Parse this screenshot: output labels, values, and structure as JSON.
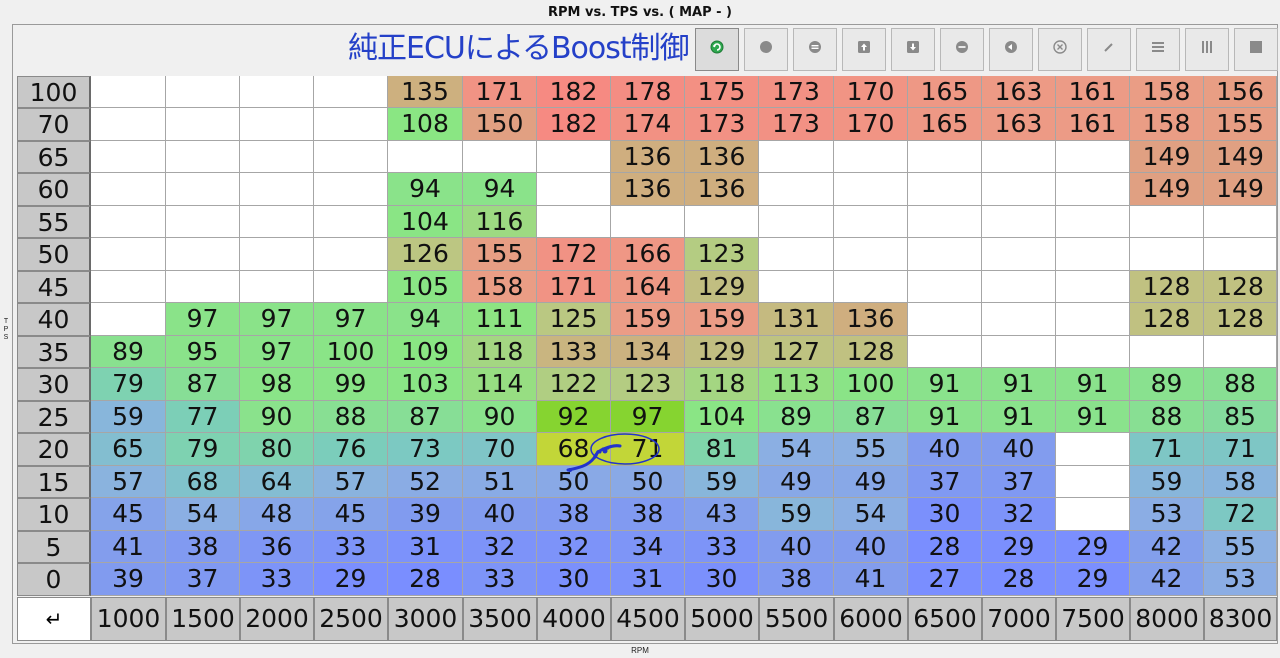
{
  "window": {
    "title": "RPM vs. TPS vs. ( MAP -   )"
  },
  "annotation": {
    "text": "純正ECUによるBoost制御",
    "color": "#2440c8"
  },
  "toolbar": {
    "buttons": [
      {
        "icon": "refresh-green-icon",
        "active": true
      },
      {
        "icon": "circle-icon",
        "active": false
      },
      {
        "icon": "equals-circle-icon",
        "active": false
      },
      {
        "icon": "arrow-up-box-icon",
        "active": false
      },
      {
        "icon": "arrow-down-box-icon",
        "active": false
      },
      {
        "icon": "minus-circle-icon",
        "active": false
      },
      {
        "icon": "plus-circle-icon",
        "active": false
      },
      {
        "icon": "x-circle-icon",
        "active": false
      },
      {
        "icon": "pencil-icon",
        "active": false
      },
      {
        "icon": "horizontal-lines-icon",
        "active": false
      },
      {
        "icon": "vertical-bars-icon",
        "active": false
      },
      {
        "icon": "filled-square-icon",
        "active": false
      }
    ]
  },
  "axes": {
    "x_label": "RPM",
    "y_label": "T P S",
    "corner_symbol": "↵"
  },
  "table": {
    "columns": [
      "1000",
      "1500",
      "2000",
      "2500",
      "3000",
      "3500",
      "4000",
      "4500",
      "5000",
      "5500",
      "6000",
      "6500",
      "7000",
      "7500",
      "8000",
      "8300"
    ],
    "rows": [
      {
        "tps": "100",
        "cells": [
          null,
          null,
          null,
          null,
          "135",
          "171",
          "182",
          "178",
          "175",
          "173",
          "170",
          "165",
          "163",
          "161",
          "158",
          "156"
        ]
      },
      {
        "tps": "70",
        "cells": [
          null,
          null,
          null,
          null,
          "108",
          "150",
          "182",
          "174",
          "173",
          "173",
          "170",
          "165",
          "163",
          "161",
          "158",
          "155"
        ]
      },
      {
        "tps": "65",
        "cells": [
          null,
          null,
          null,
          null,
          null,
          null,
          null,
          "136",
          "136",
          null,
          null,
          null,
          null,
          null,
          "149",
          "149"
        ]
      },
      {
        "tps": "60",
        "cells": [
          null,
          null,
          null,
          null,
          "94",
          "94",
          null,
          "136",
          "136",
          null,
          null,
          null,
          null,
          null,
          "149",
          "149"
        ]
      },
      {
        "tps": "55",
        "cells": [
          null,
          null,
          null,
          null,
          "104",
          "116",
          null,
          null,
          null,
          null,
          null,
          null,
          null,
          null,
          null,
          null
        ]
      },
      {
        "tps": "50",
        "cells": [
          null,
          null,
          null,
          null,
          "126",
          "155",
          "172",
          "166",
          "123",
          null,
          null,
          null,
          null,
          null,
          null,
          null
        ]
      },
      {
        "tps": "45",
        "cells": [
          null,
          null,
          null,
          null,
          "105",
          "158",
          "171",
          "164",
          "129",
          null,
          null,
          null,
          null,
          null,
          "128",
          "128"
        ]
      },
      {
        "tps": "40",
        "cells": [
          null,
          "97",
          "97",
          "97",
          "94",
          "111",
          "125",
          "159",
          "159",
          "131",
          "136",
          null,
          null,
          null,
          "128",
          "128"
        ]
      },
      {
        "tps": "35",
        "cells": [
          "89",
          "95",
          "97",
          "100",
          "109",
          "118",
          "133",
          "134",
          "129",
          "127",
          "128",
          null,
          null,
          null,
          null,
          null
        ]
      },
      {
        "tps": "30",
        "cells": [
          "79",
          "87",
          "98",
          "99",
          "103",
          "114",
          "122",
          "123",
          "118",
          "113",
          "100",
          "91",
          "91",
          "91",
          "89",
          "88"
        ]
      },
      {
        "tps": "25",
        "cells": [
          "59",
          "77",
          "90",
          "88",
          "87",
          "90",
          "92",
          "97",
          "104",
          "89",
          "87",
          "91",
          "91",
          "91",
          "88",
          "85"
        ]
      },
      {
        "tps": "20",
        "cells": [
          "65",
          "79",
          "80",
          "76",
          "73",
          "70",
          "68",
          "71",
          "81",
          "54",
          "55",
          "40",
          "40",
          null,
          "71",
          "71"
        ]
      },
      {
        "tps": "15",
        "cells": [
          "57",
          "68",
          "64",
          "57",
          "52",
          "51",
          "50",
          "50",
          "59",
          "49",
          "49",
          "37",
          "37",
          null,
          "59",
          "58"
        ]
      },
      {
        "tps": "10",
        "cells": [
          "45",
          "54",
          "48",
          "45",
          "39",
          "40",
          "38",
          "38",
          "43",
          "59",
          "54",
          "30",
          "32",
          null,
          "53",
          "72"
        ]
      },
      {
        "tps": "5",
        "cells": [
          "41",
          "38",
          "36",
          "33",
          "31",
          "32",
          "32",
          "34",
          "33",
          "40",
          "40",
          "28",
          "29",
          "29",
          "42",
          "55"
        ]
      },
      {
        "tps": "0",
        "cells": [
          "39",
          "37",
          "33",
          "29",
          "28",
          "33",
          "30",
          "31",
          "30",
          "38",
          "41",
          "27",
          "28",
          "29",
          "42",
          "53"
        ]
      }
    ],
    "highlighted_cells": [
      {
        "row": 10,
        "col": 6,
        "color": "#86d430"
      },
      {
        "row": 10,
        "col": 7,
        "color": "#86d430"
      },
      {
        "row": 11,
        "col": 6,
        "color": "#c2d638"
      },
      {
        "row": 11,
        "col": 7,
        "color": "#c2d638"
      }
    ],
    "colors": {
      "empty": "#ffffff",
      "row_header": "#c8c8c8",
      "column_header": "#c8c8c8",
      "scribble": "#2233cc"
    }
  }
}
